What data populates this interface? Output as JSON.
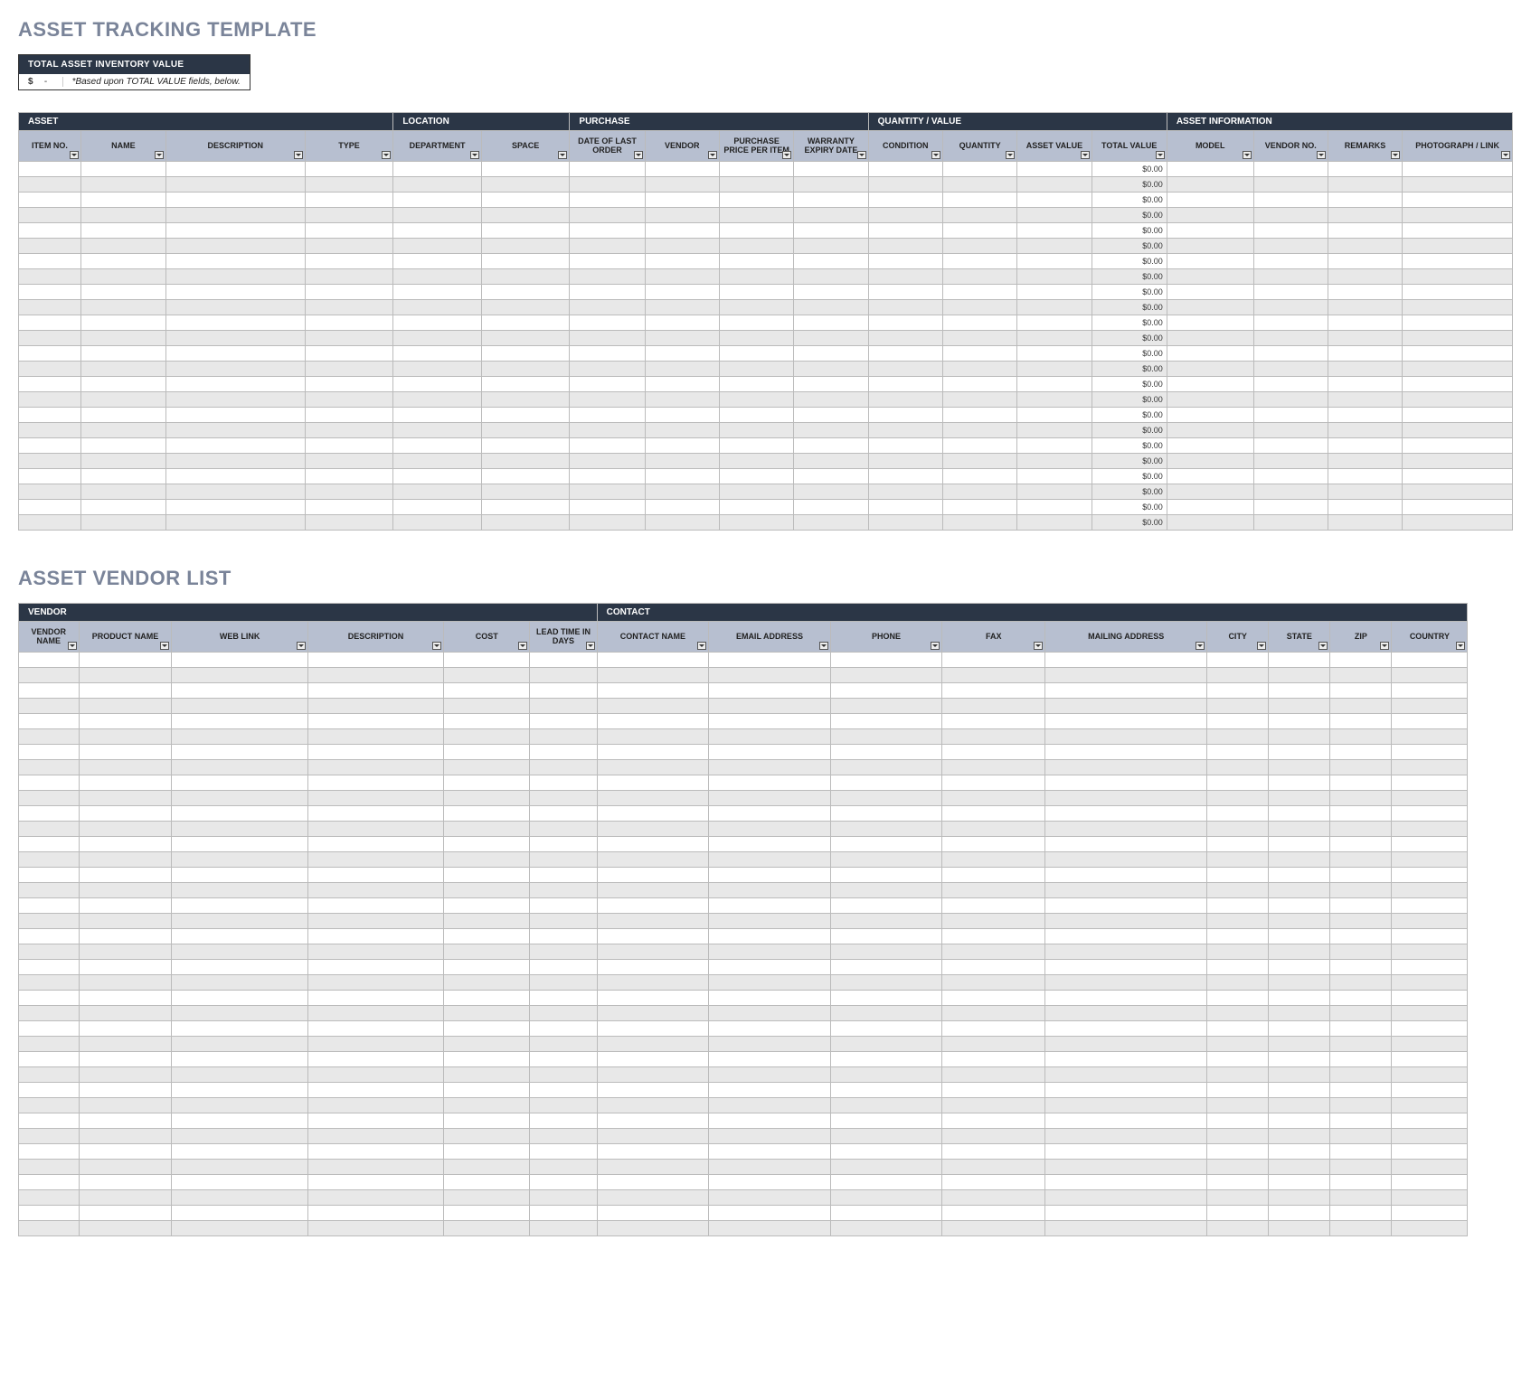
{
  "titles": {
    "asset_tracking": "ASSET TRACKING TEMPLATE",
    "vendor_list": "ASSET VENDOR LIST"
  },
  "total_box": {
    "header": "TOTAL ASSET INVENTORY VALUE",
    "currency": "$",
    "value": "-",
    "note": "*Based upon TOTAL VALUE fields, below."
  },
  "asset_table": {
    "groups": [
      {
        "label": "ASSET",
        "span": 4
      },
      {
        "label": "LOCATION",
        "span": 2
      },
      {
        "label": "PURCHASE",
        "span": 4
      },
      {
        "label": "QUANTITY / VALUE",
        "span": 4
      },
      {
        "label": "ASSET INFORMATION",
        "span": 4
      }
    ],
    "columns": [
      "ITEM NO.",
      "NAME",
      "DESCRIPTION",
      "TYPE",
      "DEPARTMENT",
      "SPACE",
      "DATE OF LAST ORDER",
      "VENDOR",
      "PURCHASE PRICE PER ITEM",
      "WARRANTY EXPIRY DATE",
      "CONDITION",
      "QUANTITY",
      "ASSET VALUE",
      "TOTAL VALUE",
      "MODEL",
      "VENDOR NO.",
      "REMARKS",
      "PHOTOGRAPH / LINK"
    ],
    "row_count": 24,
    "total_value_cell": "$0.00",
    "total_value_col_index": 13
  },
  "vendor_table": {
    "groups": [
      {
        "label": "VENDOR",
        "span": 6
      },
      {
        "label": "CONTACT",
        "span": 9
      }
    ],
    "columns": [
      "VENDOR NAME",
      "PRODUCT NAME",
      "WEB LINK",
      "DESCRIPTION",
      "COST",
      "LEAD TIME IN DAYS",
      "CONTACT NAME",
      "EMAIL ADDRESS",
      "PHONE",
      "FAX",
      "MAILING ADDRESS",
      "CITY",
      "STATE",
      "ZIP",
      "COUNTRY"
    ],
    "row_count": 38
  }
}
